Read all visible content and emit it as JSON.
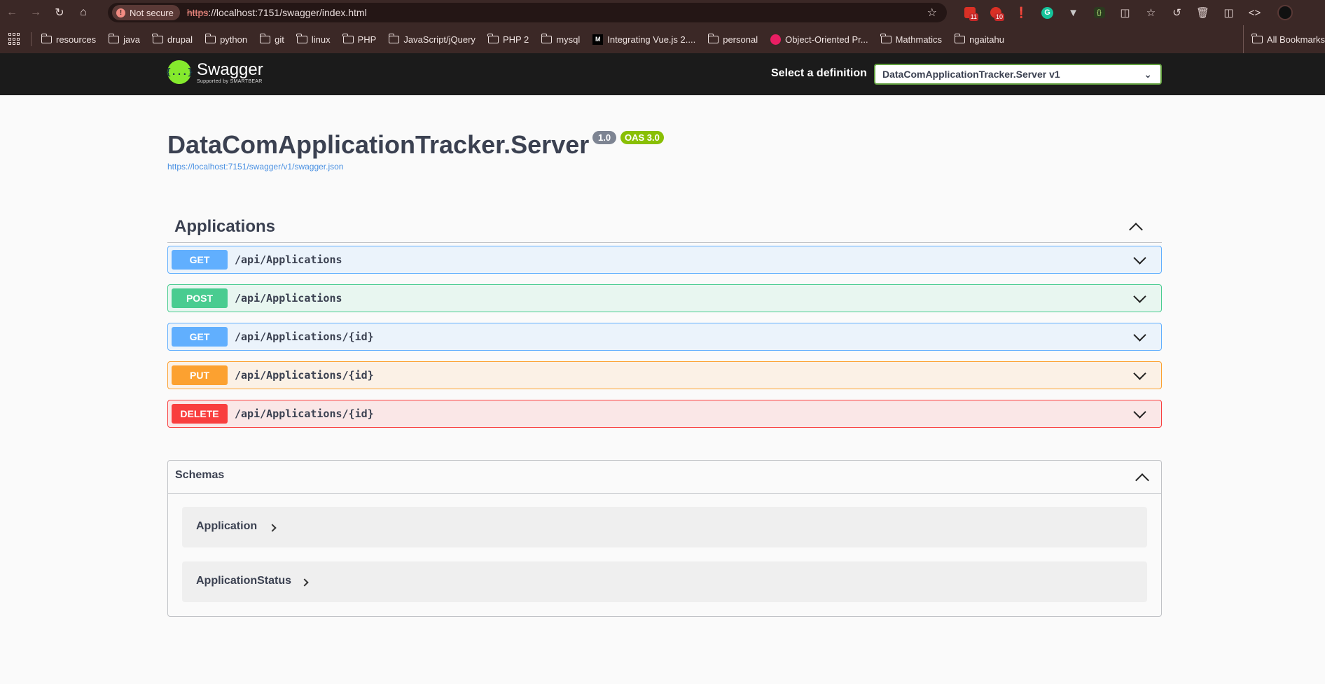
{
  "browser": {
    "not_secure_label": "Not secure",
    "url_scheme": "https",
    "url_rest": "://localhost:7151/swagger/index.html",
    "extensions": [
      {
        "name": "calendar-ext",
        "badge": "11"
      },
      {
        "name": "red-ext",
        "badge": "10"
      }
    ],
    "bookmarks": [
      {
        "label": "resources",
        "type": "folder"
      },
      {
        "label": "java",
        "type": "folder"
      },
      {
        "label": "drupal",
        "type": "folder"
      },
      {
        "label": "python",
        "type": "folder"
      },
      {
        "label": "git",
        "type": "folder"
      },
      {
        "label": "linux",
        "type": "folder"
      },
      {
        "label": "PHP",
        "type": "folder"
      },
      {
        "label": "JavaScript/jQuery",
        "type": "folder"
      },
      {
        "label": "PHP 2",
        "type": "folder"
      },
      {
        "label": "mysql",
        "type": "folder"
      },
      {
        "label": "Integrating Vue.js 2....",
        "type": "medium"
      },
      {
        "label": "personal",
        "type": "folder"
      },
      {
        "label": "Object-Oriented Pr...",
        "type": "oreilly"
      },
      {
        "label": "Mathmatics",
        "type": "folder"
      },
      {
        "label": "ngaitahu",
        "type": "folder"
      }
    ],
    "all_bookmarks_label": "All Bookmarks"
  },
  "topbar": {
    "logo_name": "Swagger",
    "logo_sub": "Supported by SMARTBEAR",
    "logo_glyph": "{...}",
    "definition_label": "Select a definition",
    "definition_value": "DataComApplicationTracker.Server v1"
  },
  "info": {
    "title": "DataComApplicationTracker.Server",
    "version": "1.0",
    "oas": "OAS 3.0",
    "spec_url": "https://localhost:7151/swagger/v1/swagger.json"
  },
  "tag": {
    "name": "Applications",
    "operations": [
      {
        "method": "GET",
        "path": "/api/Applications"
      },
      {
        "method": "POST",
        "path": "/api/Applications"
      },
      {
        "method": "GET",
        "path": "/api/Applications/{id}"
      },
      {
        "method": "PUT",
        "path": "/api/Applications/{id}"
      },
      {
        "method": "DELETE",
        "path": "/api/Applications/{id}"
      }
    ]
  },
  "schemas": {
    "title": "Schemas",
    "items": [
      "Application",
      "ApplicationStatus"
    ]
  },
  "colors": {
    "get": "#61affe",
    "post": "#49cc90",
    "put": "#fca130",
    "delete": "#f93e3e",
    "swagger_green": "#85ea2d",
    "topbar_bg": "#1b1b1b"
  }
}
